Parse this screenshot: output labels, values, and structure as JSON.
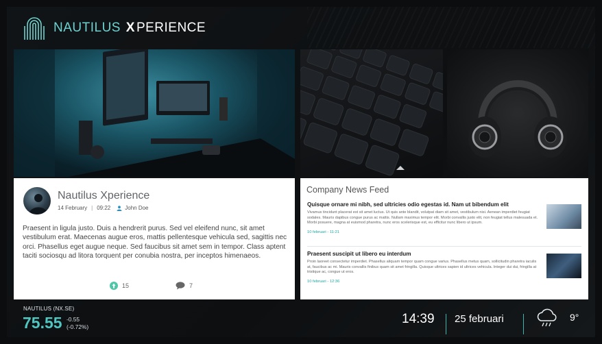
{
  "brand": {
    "name_left": "NAUTILUS",
    "name_x": "X",
    "name_right": "PERIENCE",
    "accent_color": "#6ed3d0"
  },
  "tiles": [
    {
      "name": "desk-setup-image"
    },
    {
      "name": "keyboard-image"
    },
    {
      "name": "headphones-image"
    }
  ],
  "post": {
    "title": "Nautilus Xperience",
    "date": "14 February",
    "time": "09:22",
    "author": "John Doe",
    "body": "Praesent in ligula justo. Duis a hendrerit purus. Sed vel eleifend nunc, sit amet vestibulum erat. Maecenas augue eros, mattis pellentesque vehicula sed, sagittis nec orci. Phasellus eget augue neque. Sed faucibus sit amet sem in tempor. Class aptent taciti sociosqu ad litora torquent per conubia nostra, per inceptos himenaeos.",
    "likes": "15",
    "comments": "7"
  },
  "news": {
    "heading": "Company News Feed",
    "items": [
      {
        "title": "Quisque ornare mi nibh, sed ultricies odio egestas id. Nam ut bibendum elit",
        "text": "Vivamus tincidunt placerat est sit amet luctus. Ut quis ante blandit, volutpat diam sit amet, vestibulum nisi. Aenean imperdiet feugiat sodales. Mauris dapibus congue purus ac mattis. Nullam maximus tempor elit. Morbi convallis justo elit, non feugiat tellus malesuada et. Morbi posuere, magna at euismod pharetra, nunc eros scelerisque est, eu efficitur nunc libero ut ipsum.",
        "date": "10 februari - 11:21"
      },
      {
        "title": "Praesent suscipit ut libero eu interdum",
        "text": "Proin laoreet consectetur imperdiet. Phasellus aliquam tempor quam congue varius. Phasellus metus quam, sollicitudin pharetra iaculis at, faucibus ac mi. Mauris convallis finibus quam sit amet fringilla. Quisque ultrices sapien id ultrices vehicula. Integer dui dui, fringilla at tristique ac, congue ut eros.",
        "date": "10 februari - 12:36"
      }
    ]
  },
  "ticker": {
    "symbol": "NAUTILUS (NX.SE)",
    "price": "75.55",
    "change": "-0.55",
    "change_pct": "(-0.72%)"
  },
  "clock": {
    "time": "14:39",
    "date": "25 februari"
  },
  "weather": {
    "icon": "rain-cloud-icon",
    "temperature": "9°"
  }
}
